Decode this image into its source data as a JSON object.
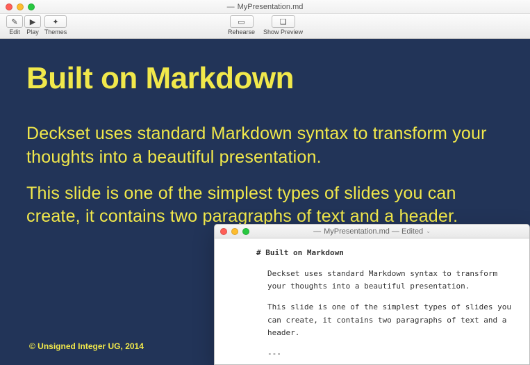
{
  "mainWindow": {
    "title": "MyPresentation.md",
    "toolbar": {
      "edit": "Edit",
      "play": "Play",
      "themes": "Themes",
      "rehearse": "Rehearse",
      "showPreview": "Show Preview"
    }
  },
  "slide": {
    "title": "Built on Markdown",
    "p1": "Deckset uses standard Markdown syntax to transform your thoughts into a beautiful presentation.",
    "p2": "This slide is one of the simplest types of slides you can create, it contains two paragraphs of text and a header.",
    "footer": "© Unsigned Integer UG, 2014"
  },
  "editorWindow": {
    "title": "MyPresentation.md — Edited",
    "md_heading": "# Built on Markdown",
    "md_p1": "Deckset uses standard Markdown syntax to transform your thoughts into a beautiful presentation.",
    "md_p2": "This slide is one of the simplest types of slides you can create, it contains two paragraphs of text and a header.",
    "md_hr": "---"
  }
}
